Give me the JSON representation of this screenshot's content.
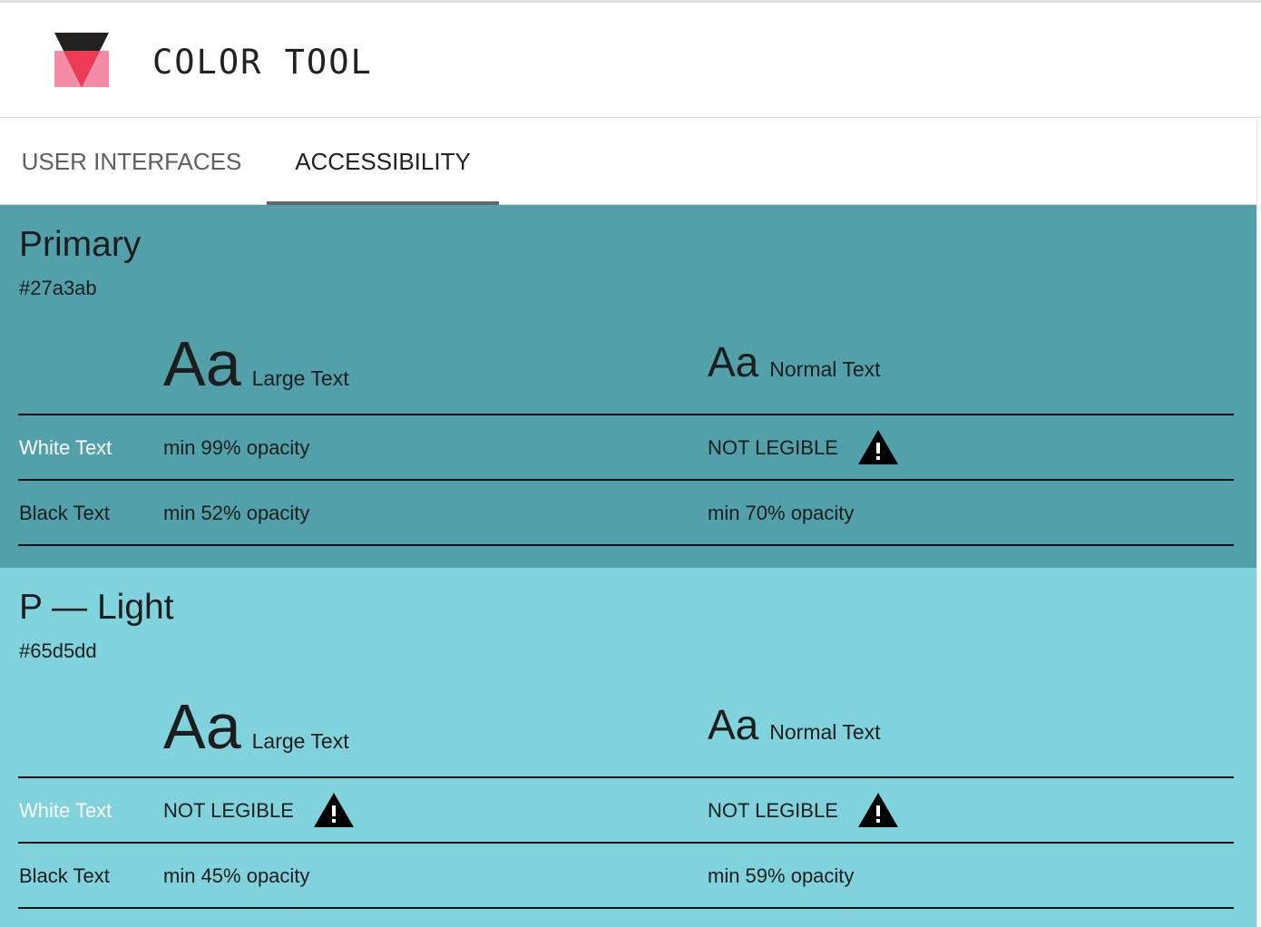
{
  "app": {
    "title": "COLOR TOOL"
  },
  "tabs": [
    {
      "label": "USER INTERFACES",
      "active": false
    },
    {
      "label": "ACCESSIBILITY",
      "active": true
    }
  ],
  "colors": {
    "primary_bg": "#51a0aa",
    "light_bg": "#80d3dc",
    "logo_dark": "#222222",
    "logo_pink": "#f48ca7",
    "logo_red": "#ee3a55"
  },
  "sections": [
    {
      "title": "Primary",
      "hex": "#27a3ab",
      "large_sample": "Aa",
      "large_label": "Large Text",
      "normal_sample": "Aa",
      "normal_label": "Normal Text",
      "rows": [
        {
          "label": "White Text",
          "large": "min 99% opacity",
          "large_warn": false,
          "normal": "NOT LEGIBLE",
          "normal_warn": true
        },
        {
          "label": "Black Text",
          "large": "min 52% opacity",
          "large_warn": false,
          "normal": "min 70% opacity",
          "normal_warn": false
        }
      ]
    },
    {
      "title": "P — Light",
      "hex": "#65d5dd",
      "large_sample": "Aa",
      "large_label": "Large Text",
      "normal_sample": "Aa",
      "normal_label": "Normal Text",
      "rows": [
        {
          "label": "White Text",
          "large": "NOT LEGIBLE",
          "large_warn": true,
          "normal": "NOT LEGIBLE",
          "normal_warn": true
        },
        {
          "label": "Black Text",
          "large": "min 45% opacity",
          "large_warn": false,
          "normal": "min 59% opacity",
          "normal_warn": false
        }
      ]
    }
  ],
  "icons": {
    "logo": "color-tool-logo",
    "warning": "warning-icon"
  }
}
